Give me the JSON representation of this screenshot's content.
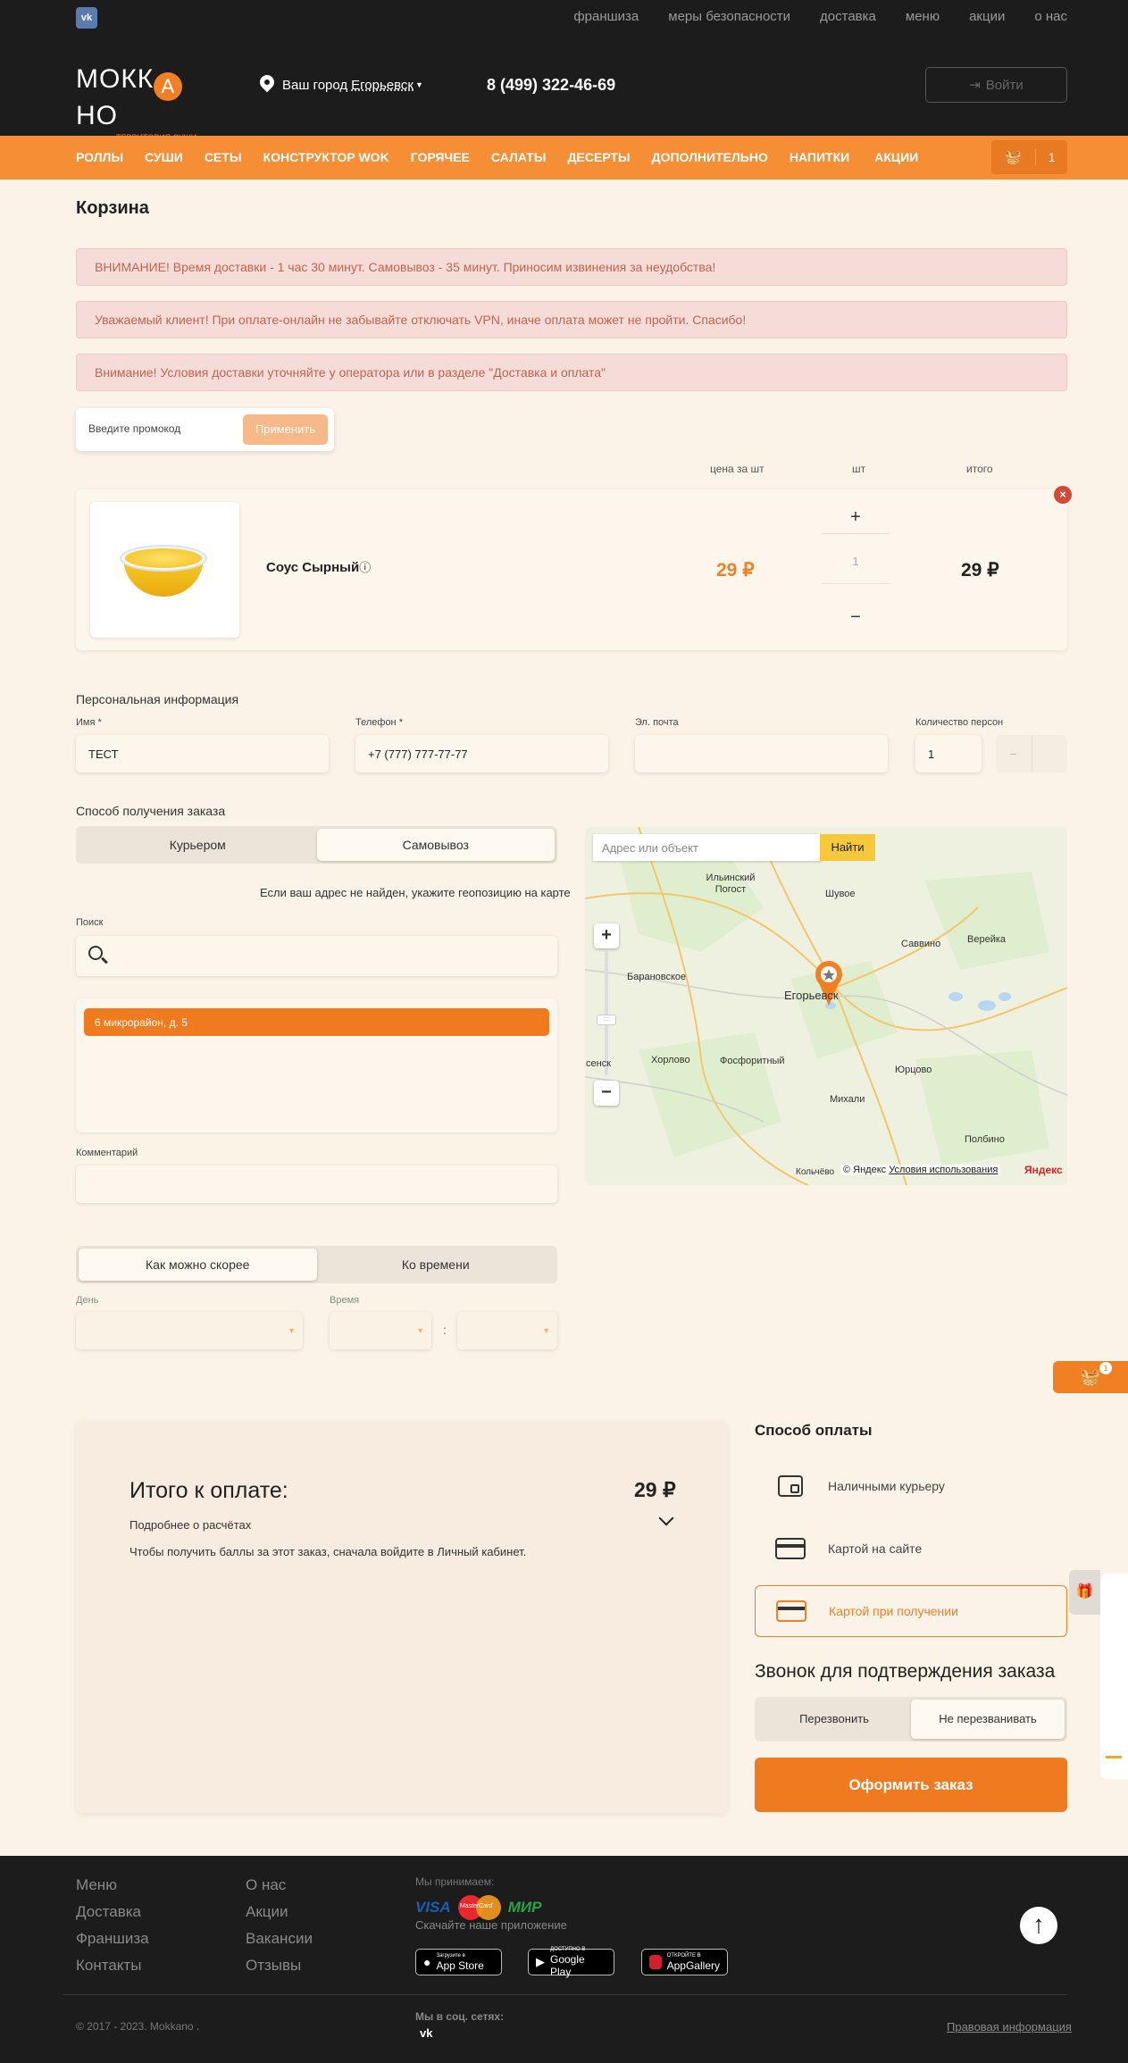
{
  "topnav": {
    "vk": "vk",
    "links": [
      "франшиза",
      "меры безопасности",
      "доставка",
      "меню",
      "акции",
      "о нас"
    ]
  },
  "header": {
    "logo_text": "МОКК НО",
    "logo_letter": "А",
    "logo_sub": "ТЕРРИТОРИЯ СУШИ",
    "city_label": "Ваш город",
    "city_name": "Егорьевск",
    "phone": "8 (499) 322-46-69",
    "login": "Войти"
  },
  "categories": [
    "РОЛЛЫ",
    "СУШИ",
    "СЕТЫ",
    "КОНСТРУКТОР WOK",
    "ГОРЯЧЕЕ",
    "САЛАТЫ",
    "ДЕСЕРТЫ",
    "ДОПОЛНИТЕЛЬНО",
    "НАПИТКИ",
    "АКЦИИ"
  ],
  "cart_count": "1",
  "page_title": "Корзина",
  "alerts": [
    "ВНИМАНИЕ! Время доставки - 1 час 30 минут. Самовывоз - 35 минут. Приносим извинения за неудобства!",
    "Уважаемый клиент! При оплате-онлайн не забывайте отключать VPN, иначе оплата может не пройти. Спасибо!",
    "Внимание! Условия доставки уточняйте у оператора или в разделе \"Доставка и оплата\""
  ],
  "promo": {
    "placeholder": "Введите промокод",
    "button": "Применить"
  },
  "columns": {
    "price": "цена за шт",
    "qty": "шт",
    "total": "итого"
  },
  "item": {
    "name": "Соус Сырный",
    "price": "29 ₽",
    "qty": "1",
    "total": "29 ₽"
  },
  "personal": {
    "section": "Персональная информация",
    "name_label": "Имя *",
    "name_value": "ТЕСТ",
    "phone_label": "Телефон *",
    "phone_value": "+7 (777) 777-77-77",
    "email_label": "Эл. почта",
    "email_value": "",
    "persons_label": "Количество персон",
    "persons_value": "1"
  },
  "delivery": {
    "section": "Способ получения заказа",
    "courier": "Курьером",
    "pickup": "Самовывоз",
    "hint": "Если ваш адрес не найден, укажите геопозицию на карте",
    "search_label": "Поиск",
    "selected_address": "6 микрорайон, д. 5",
    "comment_label": "Комментарий"
  },
  "map": {
    "search_placeholder": "Адрес или объект",
    "find": "Найти",
    "labels": [
      "Ильинский Погост",
      "Шувое",
      "Саввино",
      "Верейка",
      "Барановское",
      "Егорьевск",
      "Хорлово",
      "Фосфоритный",
      "Юрцово",
      "Михали",
      "Полбино",
      "сенск",
      "Кольчёво"
    ],
    "copyright": "© Яндекс",
    "terms": "Условия использования",
    "brand": "Яндекс"
  },
  "timing": {
    "asap": "Как можно скорее",
    "scheduled": "Ко времени",
    "day_label": "День",
    "time_label": "Время",
    "sep": ":"
  },
  "summary": {
    "title": "Итого к оплате:",
    "amount": "29 ₽",
    "details": "Подробнее о расчётах",
    "bonus_note": "Чтобы получить баллы за этот заказ, сначала войдите в Личный кабинет."
  },
  "payment": {
    "title": "Способ оплаты",
    "options": [
      "Наличными курьеру",
      "Картой на сайте",
      "Картой при получении"
    ],
    "call_title": "Звонок для подтверждения заказа",
    "call_yes": "Перезвонить",
    "call_no": "Не перезванивать",
    "submit": "Оформить заказ"
  },
  "footer": {
    "col1": [
      "Меню",
      "Доставка",
      "Франшиза",
      "Контакты"
    ],
    "col2": [
      "О нас",
      "Акции",
      "Вакансии",
      "Отзывы"
    ],
    "accept": "Мы принимаем:",
    "cards": [
      "VISA",
      "MasterCard",
      "МИР"
    ],
    "download": "Скачайте наше приложение",
    "stores": [
      {
        "small": "Загрузите в",
        "big": "App Store"
      },
      {
        "small": "ДОСТУПНО В",
        "big": "Google Play"
      },
      {
        "small": "ОТКРОЙТЕ В",
        "big": "AppGallery"
      }
    ],
    "social": "Мы в соц. сетях:",
    "copyright": "© 2017 - 2023. Mokkano .",
    "legal": "Правовая информация"
  }
}
